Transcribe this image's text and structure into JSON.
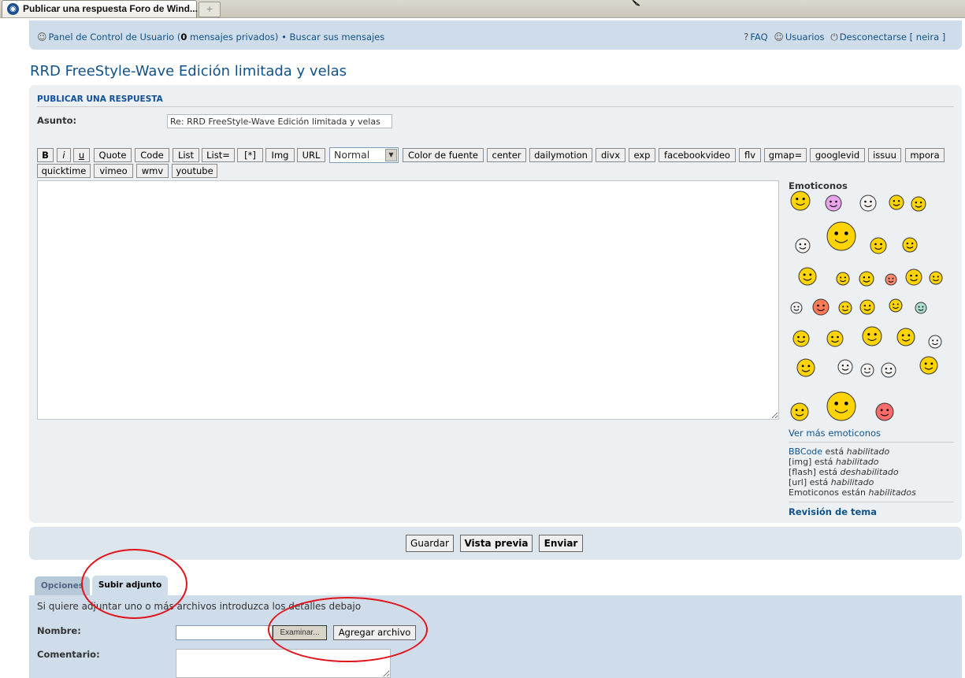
{
  "browser": {
    "tab_title": "Publicar una respuesta Foro de Wind...",
    "new_tab_symbol": "+"
  },
  "nav": {
    "ucp_prefix": "Panel de Control de Usuario (",
    "ucp_count": "0",
    "ucp_suffix": " mensajes privados)",
    "separator": "•",
    "search_own": "Buscar sus mensajes",
    "faq": "FAQ",
    "users": "Usuarios",
    "logout": "Desconectarse [ neira ]"
  },
  "page_title": "RRD FreeStyle-Wave Edición limitada y velas",
  "form": {
    "section_header": "PUBLICAR UNA RESPUESTA",
    "subject_label": "Asunto:",
    "subject_value": "Re: RRD FreeStyle-Wave Edición limitada y velas",
    "bbcode_row1": [
      "B",
      "i",
      "u",
      "Quote",
      "Code",
      "List",
      "List=",
      "[*]",
      "Img",
      "URL"
    ],
    "font_size_value": "Normal",
    "bbcode_row1b": [
      "Color de fuente",
      "center",
      "dailymotion",
      "divx",
      "exp",
      "facebookvideo",
      "flv",
      "gmap=",
      "googlevid",
      "issuu",
      "mpora"
    ],
    "bbcode_row2": [
      "quicktime",
      "vimeo",
      "wmv",
      "youtube"
    ],
    "editor_value": ""
  },
  "sidebar": {
    "emoticons_title": "Emoticonos",
    "more_emoticons": "Ver más emoticonos",
    "status": [
      {
        "name": "BBCode",
        "verb": " está ",
        "state": "habilitado"
      },
      {
        "name": "[img]",
        "verb": " está ",
        "state": "habilitado"
      },
      {
        "name": "[flash]",
        "verb": " está ",
        "state": "deshabilitado"
      },
      {
        "name": "[url]",
        "verb": " está ",
        "state": "habilitado"
      },
      {
        "name": "Emoticonos",
        "verb": " están ",
        "state": "habilitados"
      }
    ],
    "topic_review": "Revisión de tema"
  },
  "actions": {
    "save": "Guardar",
    "preview": "Vista previa",
    "submit": "Enviar"
  },
  "tabs": {
    "options": "Opciones",
    "upload": "Subir adjunto"
  },
  "attachment": {
    "intro": "Si quiere adjuntar uno o más archivos introduzca los detalles debajo",
    "name_label": "Nombre:",
    "browse": "Examinar...",
    "add_file": "Agregar archivo",
    "comment_label": "Comentario:"
  },
  "colors": {
    "link": "#105289",
    "panel": "#cfdce9",
    "form_bg": "#ecf0f3",
    "annotation": "#e0131b"
  },
  "emoticons": [
    "scared-smiley-icon",
    "of-smiley-icon",
    "10-smiley-icon",
    "pink-smiley-icon",
    "waving-smiley-icon",
    "ghost-smiley-icon",
    "windsurf-smiley-icon",
    "rasta-smiley-icon",
    "banana-smiley-icon",
    "zoom-smiley-icon",
    "yellow-smiley-icon",
    "thumbs-smiley-icon",
    "red-smiley-icon",
    "hand-smiley-icon",
    "black-smiley-icon",
    "pale-smiley-icon",
    "duo-smiley-icon",
    "yellow2-smiley-icon",
    "bang-smiley-icon",
    "plain-smiley-icon",
    "green-smiley-icon",
    "sign-smiley-icon",
    "cheer-smiley-icon",
    "dance-smiley-icon",
    "banana2-smiley-icon",
    "skull-smiley-icon",
    "pink2-smiley-icon",
    "gray-smiley-icon",
    "white-smiley-icon",
    "tongue-smiley-icon",
    "hat-smiley-icon",
    "pirate-smiley-icon",
    "kite-smiley-icon",
    "devil-smiley-icon"
  ]
}
